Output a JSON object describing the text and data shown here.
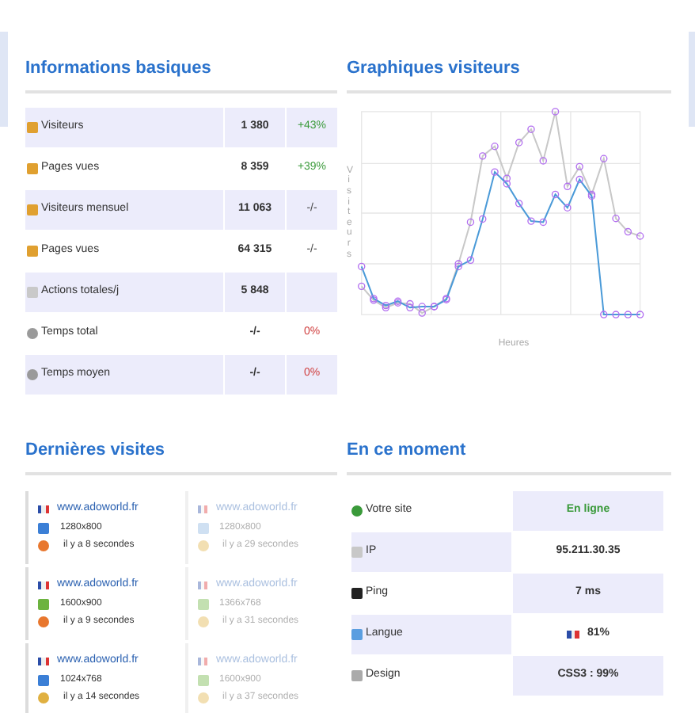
{
  "basic_info": {
    "title": "Informations basiques",
    "rows": [
      {
        "label": "Visiteurs",
        "value": "1 380",
        "delta": "+43%",
        "color": "#3a9a3a"
      },
      {
        "label": "Pages vues",
        "value": "8 359",
        "delta": "+39%",
        "color": "#3a9a3a"
      },
      {
        "label": "Visiteurs mensuel",
        "value": "11 063",
        "delta": "-/-"
      },
      {
        "label": "Pages vues",
        "value": "64 315",
        "delta": "-/-"
      },
      {
        "label": "Actions totales/j",
        "value": "5 848"
      },
      {
        "label": "Temps total",
        "value": "-/-",
        "delta": "0%",
        "color": "#d04040"
      },
      {
        "label": "Temps moyen",
        "value": "-/-",
        "delta": "0%",
        "color": "#d04040"
      }
    ]
  },
  "visitor_chart": {
    "title": "Graphiques visiteurs",
    "ylabel": "Visiteurs",
    "xlabel": "Heures"
  },
  "recent_visits": {
    "title": "Dernières visites",
    "items": [
      {
        "site": "www.adoworld.fr",
        "resolution": "1280x800",
        "time": "il y a 8 secondes",
        "faded": false
      },
      {
        "site": "www.adoworld.fr",
        "resolution": "1280x800",
        "time": "il y a 29 secondes",
        "faded": true
      },
      {
        "site": "www.adoworld.fr",
        "resolution": "1600x900",
        "time": "il y a 9 secondes",
        "faded": false
      },
      {
        "site": "www.adoworld.fr",
        "resolution": "1366x768",
        "time": "il y a 31 secondes",
        "faded": true
      },
      {
        "site": "www.adoworld.fr",
        "resolution": "1024x768",
        "time": "il y a 14 secondes",
        "faded": false
      },
      {
        "site": "www.adoworld.fr",
        "resolution": "1600x900",
        "time": "il y a 37 secondes",
        "faded": true
      }
    ]
  },
  "now": {
    "title": "En ce moment",
    "rows": [
      {
        "label": "Votre site",
        "value": "En ligne",
        "kind": "status"
      },
      {
        "label": "IP",
        "value": "95.211.30.35",
        "kind": "text"
      },
      {
        "label": "Ping",
        "value": "7 ms",
        "kind": "text"
      },
      {
        "label": "Langue",
        "value": "81%",
        "kind": "flag"
      },
      {
        "label": "Design",
        "value": "CSS3 : 99%",
        "kind": "text"
      }
    ]
  }
}
